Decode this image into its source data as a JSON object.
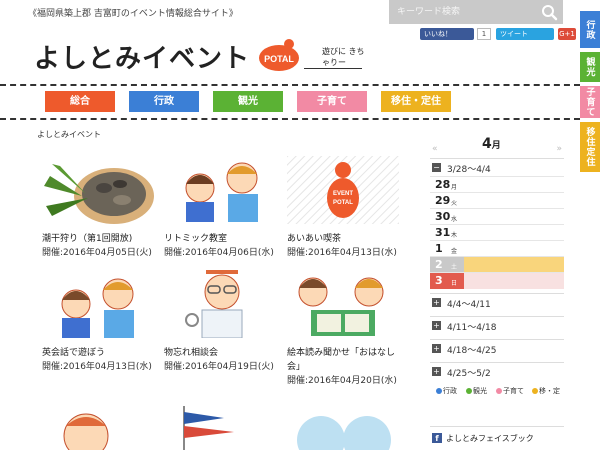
{
  "header": {
    "tagline": "《福岡県築上郡 吉富町のイベント情報総合サイト》",
    "search_placeholder": "キーワード検索",
    "logo_text": "よしとみイベント",
    "logo_badge": "POTAL",
    "logo_sub": "遊びに きちゃりー",
    "social": {
      "fb_label": "いいね！",
      "fb_count": "1",
      "tw_label": "ツイート",
      "gplus_label": "G+1"
    }
  },
  "nav": [
    {
      "label": "総合",
      "color": "#ee5a2c"
    },
    {
      "label": "行政",
      "color": "#3b7fd6"
    },
    {
      "label": "観光",
      "color": "#5bb234"
    },
    {
      "label": "子育て",
      "color": "#f28aa4"
    },
    {
      "label": "移住・定住",
      "color": "#edb21f"
    }
  ],
  "side_tabs": [
    {
      "label": "行政",
      "color": "#3b7fd6"
    },
    {
      "label": "観光",
      "color": "#5bb234"
    },
    {
      "label": "子育て",
      "color": "#f28aa4"
    },
    {
      "label": "移住定住",
      "color": "#edb21f"
    }
  ],
  "breadcrumb": "よしとみイベント",
  "events": [
    {
      "title": "潮干狩り（第1回開放)",
      "date": "開催:2016年04月05日(火)",
      "icon": "clams-basket-image"
    },
    {
      "title": "リトミック教室",
      "date": "開催:2016年04月06日(水)",
      "icon": "children-illustration"
    },
    {
      "title": "あいあい喫茶",
      "date": "開催:2016年04月13日(水)",
      "icon": "event-potal-logo"
    },
    {
      "title": "英会話で遊ぼう",
      "date": "開催:2016年04月13日(水)",
      "icon": "children-illustration"
    },
    {
      "title": "物忘れ相談会",
      "date": "開催:2016年04月19日(火)",
      "icon": "doctor-illustration"
    },
    {
      "title": "絵本読み聞かせ「おはなし",
      "title2": "会」",
      "date": "開催:2016年04月20日(水)",
      "icon": "kids-reading-illustration"
    }
  ],
  "calendar": {
    "month": "4",
    "month_suffix": "月",
    "prev": "«",
    "next": "»",
    "ranges_top": [
      {
        "label": "3/28〜4/4",
        "toggle": "−"
      }
    ],
    "days": [
      {
        "num": "28",
        "wd": "月",
        "bar": null
      },
      {
        "num": "29",
        "wd": "火",
        "bar": null
      },
      {
        "num": "30",
        "wd": "水",
        "bar": null
      },
      {
        "num": "31",
        "wd": "木",
        "bar": null
      },
      {
        "num": "1",
        "wd": "金",
        "bar": null
      },
      {
        "num": "2",
        "wd": "土",
        "bar": "#f9d57c",
        "bg": "#c9c9c9",
        "numcolor": "#fff"
      },
      {
        "num": "3",
        "wd": "日",
        "bar": "#f8e1e1",
        "bg": "#e25b4e",
        "numcolor": "#fff"
      }
    ],
    "ranges_bottom": [
      {
        "label": "4/4〜4/11",
        "toggle": "+"
      },
      {
        "label": "4/11〜4/18",
        "toggle": "+"
      },
      {
        "label": "4/18〜4/25",
        "toggle": "+"
      },
      {
        "label": "4/25〜5/2",
        "toggle": "+"
      }
    ],
    "legend": [
      {
        "label": "行政",
        "color": "#3b7fd6"
      },
      {
        "label": "観光",
        "color": "#5bb234"
      },
      {
        "label": "子育て",
        "color": "#f28aa4"
      },
      {
        "label": "移・定",
        "color": "#edb21f"
      }
    ],
    "facebook_label": "よしとみフェイスブック"
  }
}
